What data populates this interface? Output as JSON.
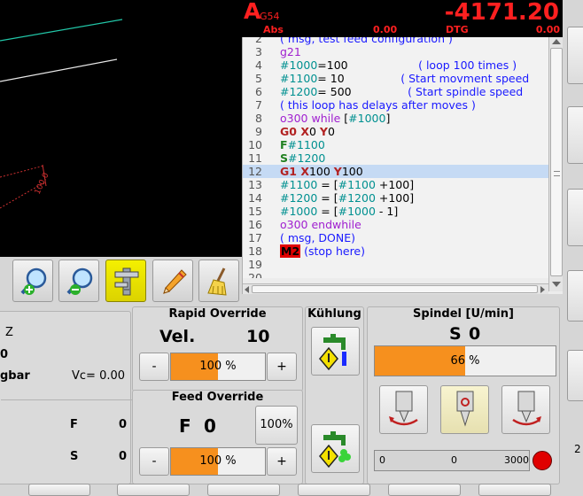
{
  "dro": {
    "axis": "A",
    "coord_system": "G54",
    "value": "-4171.20",
    "abs_label": "Abs",
    "abs_value": "0.00",
    "dtg_label": "DTG",
    "dtg_value": "0.00"
  },
  "preview": {
    "scale_label": "100.0"
  },
  "editor": {
    "lines": [
      {
        "n": "2",
        "parts": [
          [
            "c-comment",
            "( msg, test feed configuration )"
          ]
        ]
      },
      {
        "n": "3",
        "parts": [
          [
            "c-o",
            "g21"
          ]
        ]
      },
      {
        "n": "4",
        "parts": [
          [
            "c-var",
            "#1000"
          ],
          [
            "c-plain",
            "=100"
          ],
          [
            "c-comment",
            "                    ( loop 100 times )"
          ]
        ]
      },
      {
        "n": "5",
        "parts": [
          [
            "c-var",
            "#1100"
          ],
          [
            "c-plain",
            "= 10"
          ],
          [
            "c-comment",
            "                ( Start movment speed"
          ]
        ]
      },
      {
        "n": "6",
        "parts": [
          [
            "c-var",
            "#1200"
          ],
          [
            "c-plain",
            "= 500"
          ],
          [
            "c-comment",
            "                ( Start spindle speed"
          ]
        ]
      },
      {
        "n": "7",
        "parts": [
          [
            "c-comment",
            "( this loop has delays after moves )"
          ]
        ]
      },
      {
        "n": "8",
        "parts": [
          [
            "c-o",
            "o300 while "
          ],
          [
            "c-plain",
            "["
          ],
          [
            "c-var",
            "#1000"
          ],
          [
            "c-plain",
            "]"
          ]
        ]
      },
      {
        "n": "9",
        "parts": [
          [
            "c-g0",
            "G0 "
          ],
          [
            "c-axis",
            "X"
          ],
          [
            "c-plain",
            "0 "
          ],
          [
            "c-axis",
            "Y"
          ],
          [
            "c-plain",
            "0"
          ]
        ]
      },
      {
        "n": "10",
        "parts": [
          [
            "c-f",
            "F"
          ],
          [
            "c-var",
            "#1100"
          ]
        ]
      },
      {
        "n": "11",
        "parts": [
          [
            "c-f",
            "S"
          ],
          [
            "c-var",
            "#1200"
          ]
        ]
      },
      {
        "n": "12",
        "parts": [
          [
            "c-g0",
            "G1 "
          ],
          [
            "c-axis",
            "X"
          ],
          [
            "c-plain",
            "100 "
          ],
          [
            "c-axis",
            "Y"
          ],
          [
            "c-plain",
            "100"
          ]
        ],
        "current": true
      },
      {
        "n": "13",
        "parts": [
          [
            "c-var",
            "#1100"
          ],
          [
            "c-plain",
            " = ["
          ],
          [
            "c-var",
            "#1100"
          ],
          [
            "c-plain",
            " +100]"
          ]
        ]
      },
      {
        "n": "14",
        "parts": [
          [
            "c-var",
            "#1200"
          ],
          [
            "c-plain",
            " = ["
          ],
          [
            "c-var",
            "#1200"
          ],
          [
            "c-plain",
            " +100]"
          ]
        ]
      },
      {
        "n": "15",
        "parts": [
          [
            "c-var",
            "#1000"
          ],
          [
            "c-plain",
            " = ["
          ],
          [
            "c-var",
            "#1000"
          ],
          [
            "c-plain",
            " - 1]"
          ]
        ]
      },
      {
        "n": "16",
        "parts": [
          [
            "c-o",
            "o300 endwhile"
          ]
        ]
      },
      {
        "n": "17",
        "parts": [
          [
            "c-comment",
            "( msg, DONE)"
          ]
        ]
      },
      {
        "n": "18",
        "parts": [
          [
            "c-m2",
            "M2"
          ],
          [
            "c-comment",
            " (stop here)"
          ]
        ]
      },
      {
        "n": "19",
        "parts": []
      },
      {
        "n": "20",
        "parts": []
      }
    ]
  },
  "toolbar": {
    "buttons": [
      {
        "name": "zoom-in-button",
        "icon": "zoom-in-icon"
      },
      {
        "name": "zoom-out-button",
        "icon": "zoom-out-icon"
      },
      {
        "name": "tool-view-button",
        "icon": "caliper-icon",
        "active": true
      },
      {
        "name": "edit-button",
        "icon": "pencil-icon"
      },
      {
        "name": "clear-plot-button",
        "icon": "broom-icon"
      }
    ]
  },
  "left_info": {
    "axis_z": "Z",
    "zero": "0",
    "mode": "gbar",
    "vc": "Vc= 0.00",
    "f_label": "F",
    "f_value": "0",
    "s_label": "S",
    "s_value": "0"
  },
  "rapid": {
    "title": "Rapid Override",
    "vel_label": "Vel.",
    "vel_value": "10",
    "minus": "-",
    "plus": "+",
    "percent": "100 %",
    "fraction": 0.5
  },
  "feed": {
    "title": "Feed Override",
    "label": "F",
    "value": "0",
    "reset": "100%",
    "minus": "-",
    "plus": "+",
    "percent": "100 %",
    "fraction": 0.5
  },
  "coolant": {
    "title": "Kühlung"
  },
  "spindle": {
    "title": "Spindel [U/min]",
    "label": "S",
    "value": "0",
    "percent": "66 %",
    "fraction": 0.5,
    "meter_min": "0",
    "meter_mid": "0",
    "meter_max": "3000",
    "status_color": "#e00000"
  },
  "colors": {
    "accent": "#f6901e",
    "dro_red": "#ff2020",
    "highlight": "#c5daf4"
  }
}
